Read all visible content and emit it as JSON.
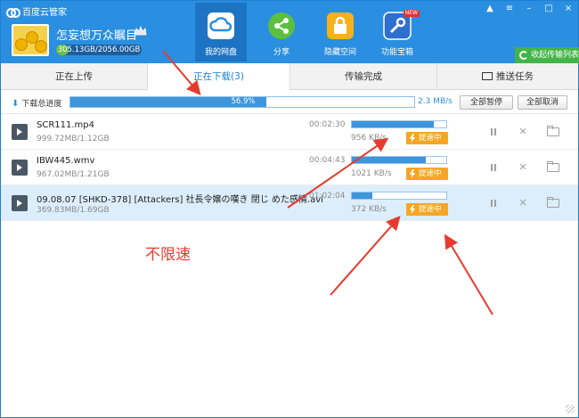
{
  "app": {
    "title": "百度云管家"
  },
  "user": {
    "name": "怎妄想万众瞩目",
    "quota_text": "305.13GB/2056.00GB",
    "quota_used_fraction": 0.148
  },
  "nav": [
    {
      "label": "我的网盘",
      "icon": "cloud-drive-icon",
      "active": true
    },
    {
      "label": "分享",
      "icon": "share-icon",
      "active": false
    },
    {
      "label": "隐藏空间",
      "icon": "lock-icon",
      "active": false
    },
    {
      "label": "功能宝箱",
      "icon": "toolbox-icon",
      "active": false,
      "badge": "NEW"
    }
  ],
  "window_controls": {
    "bell": "▲",
    "menu": "≡",
    "min": "–",
    "max": "□",
    "close": "×"
  },
  "switch_button": {
    "label": "收起传输列表"
  },
  "tabs": [
    {
      "label": "正在上传"
    },
    {
      "label": "正在下载(3)",
      "active": true
    },
    {
      "label": "传输完成"
    },
    {
      "label": "推送任务",
      "icon": "push-icon"
    }
  ],
  "total": {
    "label": "下载总进度",
    "percent_text": "56.9%",
    "fraction": 0.569,
    "speed": "2.3 MB/s",
    "pause_all": "全部暂停",
    "cancel_all": "全部取消"
  },
  "downloads": [
    {
      "name": "SCR111.mp4",
      "size": "999.72MB/1.12GB",
      "time": "00:02:30",
      "progress": 0.87,
      "speed": "956 KB/s",
      "accel": "提速中",
      "selected": false
    },
    {
      "name": "IBW445.wmv",
      "size": "967.02MB/1.21GB",
      "time": "00:04:43",
      "progress": 0.78,
      "speed": "1021 KB/s",
      "accel": "提速中",
      "selected": false
    },
    {
      "name": "09.08.07 [SHKD-378] [Attackers] 社長令嬢の嘆き 閉じ めた感情.avi",
      "size": "369.83MB/1.69GB",
      "time": "01:02:04",
      "progress": 0.22,
      "speed": "372 KB/s",
      "accel": "提速中",
      "selected": true
    }
  ],
  "annotation": {
    "text": "不限速",
    "color": "#e63b2e"
  }
}
